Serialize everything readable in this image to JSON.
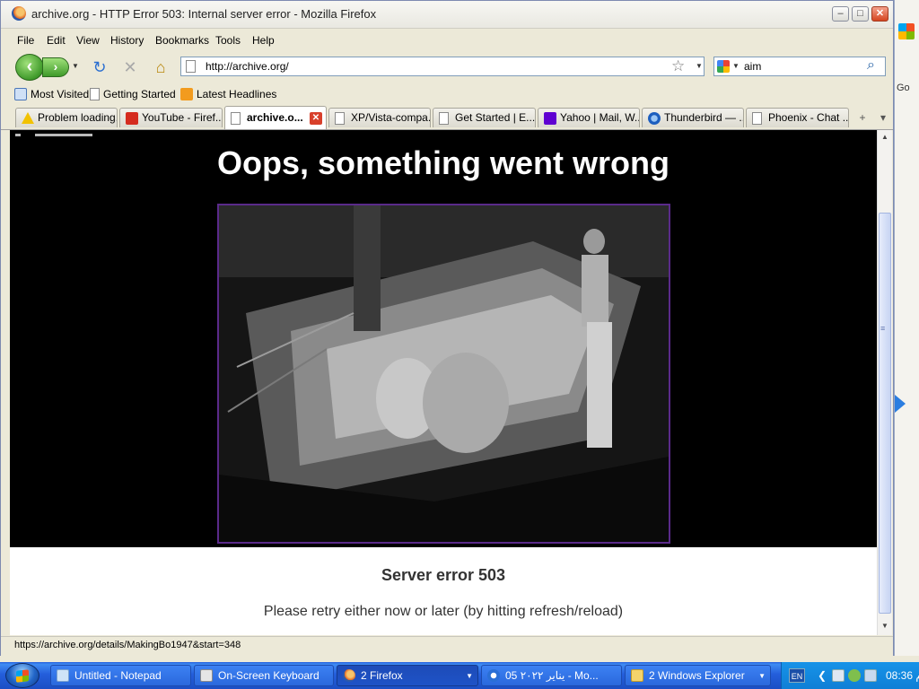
{
  "window": {
    "title": "archive.org - HTTP Error 503: Internal server error - Mozilla Firefox",
    "controls": {
      "minimize": "–",
      "maximize": "□",
      "close": "✕"
    }
  },
  "menu": [
    "File",
    "Edit",
    "View",
    "History",
    "Bookmarks",
    "Tools",
    "Help"
  ],
  "nav": {
    "back_glyph": "‹",
    "forward_glyph": "›",
    "dropdown_glyph": "▼",
    "reload_icon": "reload-icon",
    "stop_icon": "stop-icon",
    "home_icon": "home-icon",
    "url": "http://archive.org/",
    "star_glyph": "☆"
  },
  "search": {
    "value": "aim",
    "engine_icon": "google-icon"
  },
  "bookmarks": [
    "Most Visited",
    "Getting Started",
    "Latest Headlines"
  ],
  "tabs": [
    {
      "label": "Problem loading..."
    },
    {
      "label": "YouTube - Firef..."
    },
    {
      "label": "archive.o...",
      "active": true
    },
    {
      "label": "XP/Vista-compa..."
    },
    {
      "label": "Get Started | E..."
    },
    {
      "label": "Yahoo | Mail, W..."
    },
    {
      "label": "Thunderbird — ..."
    },
    {
      "label": "Phoenix - Chat ..."
    }
  ],
  "tab_controls": {
    "new_tab": "+",
    "list_tabs": "▾"
  },
  "page": {
    "heading": "Oops, something went wrong",
    "image_alt": "black-and-white photo of a worker at a factory machine",
    "error_title": "Server error 503",
    "error_message": "Please retry either now or later (by hitting refresh/reload)"
  },
  "status": "https://archive.org/details/MakingBo1947&start=348",
  "background_window": {
    "toolbar_text": "Go"
  },
  "taskbar": {
    "items": [
      {
        "label": "Untitled - Notepad"
      },
      {
        "label": "On-Screen Keyboard"
      },
      {
        "label": "2 Firefox",
        "active": true
      },
      {
        "label": "05 يناير ٢٠٢٢ - Mo..."
      },
      {
        "label": "2 Windows Explorer"
      }
    ],
    "tray": {
      "language": "EN",
      "clock": "08:36 م"
    }
  },
  "colors": {
    "taskbar": "#245edb",
    "tray": "#0f7fd6",
    "hero_bg": "#000000",
    "photo_border": "#5a2a8a"
  }
}
